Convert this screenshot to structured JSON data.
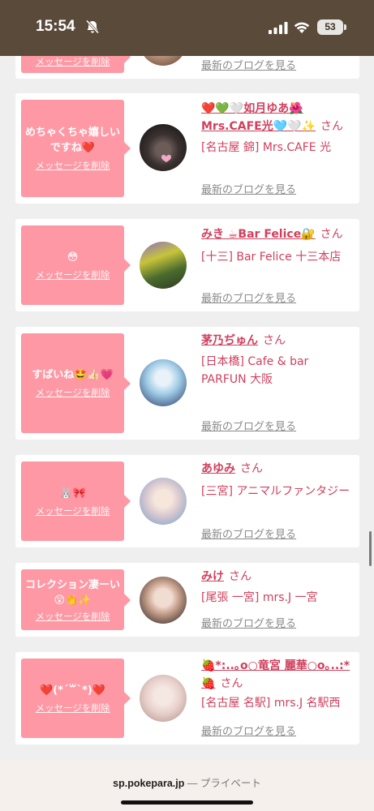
{
  "status": {
    "time": "15:54",
    "battery": "53"
  },
  "browser": {
    "domain": "sp.pokepara.jp",
    "separator": " — ",
    "mode": "プライベート"
  },
  "common": {
    "delete_label": "メッセージを削除",
    "blog_label": "最新のブログを見る",
    "san": "さん"
  },
  "cards": [
    {
      "message": "",
      "name": "",
      "shop": "",
      "avatar_colors": [
        "#caa38c",
        "#7a5a48"
      ]
    },
    {
      "message": "めちゃくちゃ嬉しいですね❤️",
      "name": "❤️💚🤍如月ゆあ🌺Mrs.CAFE光🩵🤍✨",
      "shop": "[名古屋 錦] Mrs.CAFE 光",
      "avatar_colors": [
        "#3a3230",
        "#1c1817"
      ]
    },
    {
      "message": "😳",
      "name": "みき ☕Bar Felice🔐",
      "shop": "[十三] Bar Felice 十三本店",
      "avatar_colors": [
        "#8a6cc9",
        "#3f5c28"
      ]
    },
    {
      "message": "すばいね🤩👍🏻💗",
      "name": "茅乃ぢゅん",
      "shop": "[日本橋] Cafe & bar PARFUN 大阪",
      "avatar_colors": [
        "#bfe0f2",
        "#3b4f7a"
      ]
    },
    {
      "message": "🐰🎀",
      "name": "あゆみ",
      "shop": "[三宮] アニマルファンタジー",
      "avatar_colors": [
        "#f1e6ea",
        "#7fa6cc"
      ]
    },
    {
      "message": "コレクション凄ーい😲👏✨",
      "name": "みけ",
      "shop": "[尾張 一宮] mrs.J 一宮",
      "avatar_colors": [
        "#c9a28e",
        "#3a2f2b"
      ]
    },
    {
      "message": "❤️(*´꒳`*)❤️",
      "name": "🍓*:..｡o○竜宮 麗華○o｡..:*🍓",
      "shop": "[名古屋 名駅] mrs.J 名駅西",
      "avatar_colors": [
        "#e8d0cc",
        "#b79a8e"
      ]
    }
  ]
}
